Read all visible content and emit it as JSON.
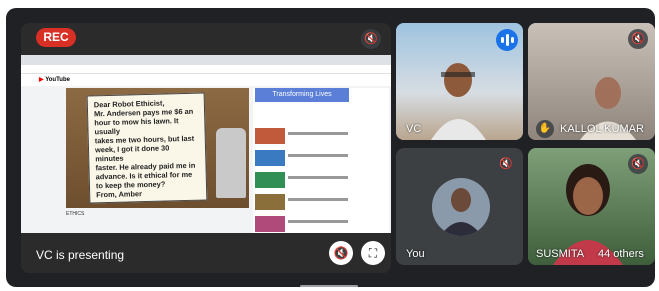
{
  "recording": {
    "label": "REC",
    "color": "#d93025"
  },
  "presentation": {
    "presenter_label": "VC is presenting",
    "browser": {
      "youtube_logo": "YouTube",
      "banner": "Transforming Lives",
      "note_lines": [
        "Dear Robot Ethicist,",
        "Mr. Andersen pays me $6 an",
        "hour to mow his lawn. It usually",
        "takes me two hours, but last",
        "week, I got it done 30 minutes",
        "faster. He already paid me in",
        "advance. Is it ethical for me",
        "to keep the money?",
        "From, Amber"
      ],
      "video_caption": "ETHICS"
    },
    "buttons": {
      "mic_icon": "mic-off-icon",
      "fullscreen_icon": "fullscreen-icon"
    }
  },
  "participants": [
    {
      "id": "vc",
      "name": "VC",
      "status_icon": "speaking-icon"
    },
    {
      "id": "kallol",
      "name": "KALLOL KUMAR",
      "status_icon": "mic-off-icon",
      "extra_icon": "raised-hand-icon"
    },
    {
      "id": "you",
      "name": "You",
      "status_icon": "mic-off-icon"
    },
    {
      "id": "susmita",
      "name": "SUSMITA",
      "status_icon": "mic-off-icon",
      "others_count": "44 others"
    }
  ],
  "colors": {
    "accent": "#1a73e8",
    "background": "#202124",
    "tile": "#3c4043"
  }
}
